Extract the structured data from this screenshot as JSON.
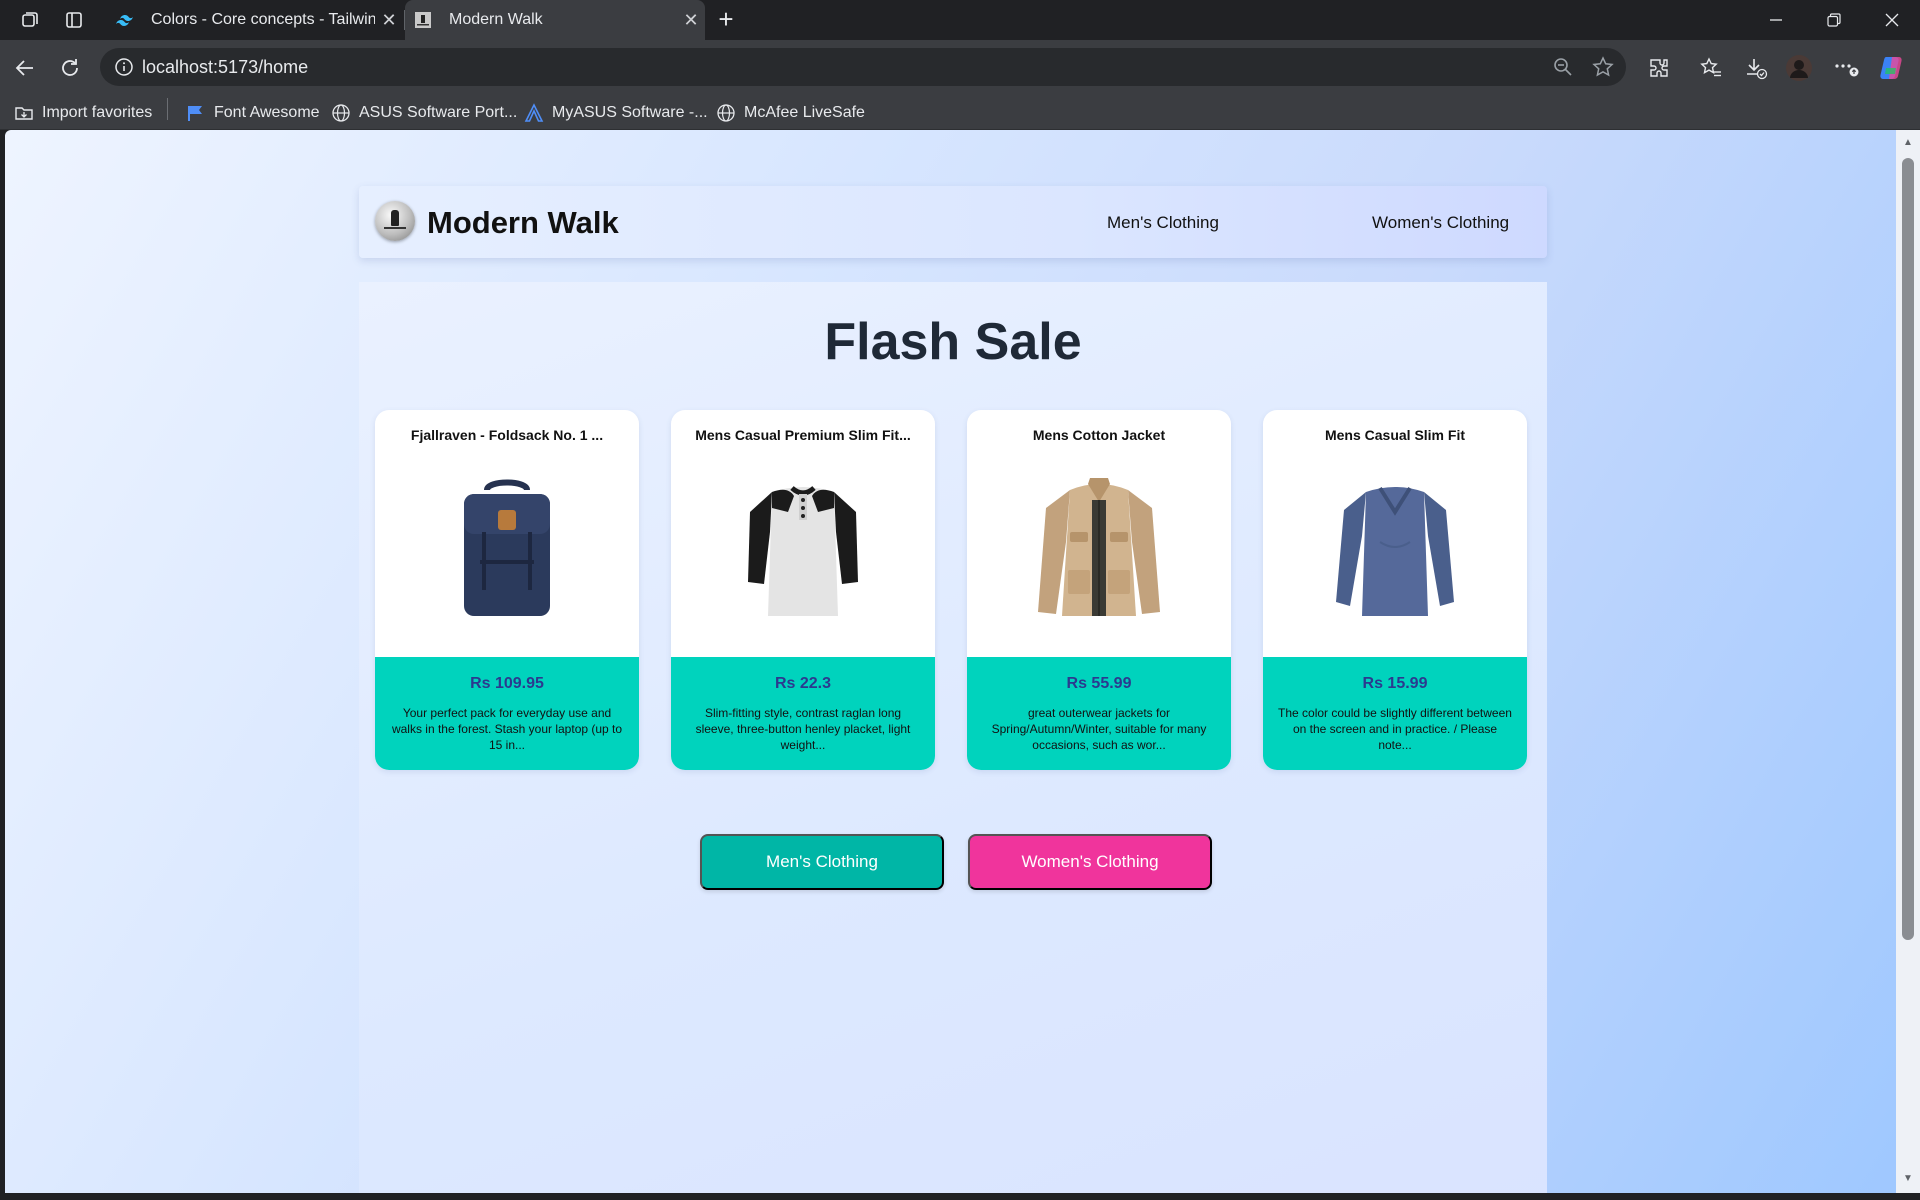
{
  "browser": {
    "tabs": [
      {
        "title": "Colors - Core concepts - Tailwind",
        "favicon": "tailwind-icon",
        "active": false
      },
      {
        "title": "Modern Walk",
        "favicon": "site-favicon",
        "active": true
      }
    ],
    "url": "localhost:5173/home",
    "bookmarks": [
      {
        "label": "Import favorites",
        "icon": "import-icon"
      },
      {
        "label": "Font Awesome",
        "icon": "flag-icon"
      },
      {
        "label": "ASUS Software Port...",
        "icon": "globe-icon"
      },
      {
        "label": "MyASUS Software -...",
        "icon": "asus-icon"
      },
      {
        "label": "McAfee LiveSafe",
        "icon": "globe-icon"
      }
    ]
  },
  "site": {
    "brand": "Modern Walk",
    "nav": [
      {
        "label": "Men's Clothing"
      },
      {
        "label": "Women's Clothing"
      }
    ],
    "title": "Flash Sale",
    "products": [
      {
        "name": "Fjallraven - Foldsack No. 1 ...",
        "price": "Rs 109.95",
        "description": "Your perfect pack for everyday use and walks in the forest. Stash your laptop (up to 15 in...",
        "image": "backpack"
      },
      {
        "name": "Mens Casual Premium Slim Fit...",
        "price": "Rs 22.3",
        "description": "Slim-fitting style, contrast raglan long sleeve, three-button henley placket, light weight...",
        "image": "henley-shirt"
      },
      {
        "name": "Mens Cotton Jacket",
        "price": "Rs 55.99",
        "description": "great outerwear jackets for Spring/Autumn/Winter, suitable for many occasions, such as wor...",
        "image": "cotton-jacket"
      },
      {
        "name": "Mens Casual Slim Fit",
        "price": "Rs 15.99",
        "description": "The color could be slightly different between on the screen and in practice. / Please note...",
        "image": "slim-fit-tee"
      }
    ],
    "buttons": {
      "men": "Men's Clothing",
      "women": "Women's Clothing"
    },
    "colors": {
      "card_info_bg": "#00d3bd",
      "price_text": "#2b3a8f",
      "men_button": "#00b6a6",
      "women_button": "#f0349c",
      "title_text": "#1f2937"
    }
  }
}
